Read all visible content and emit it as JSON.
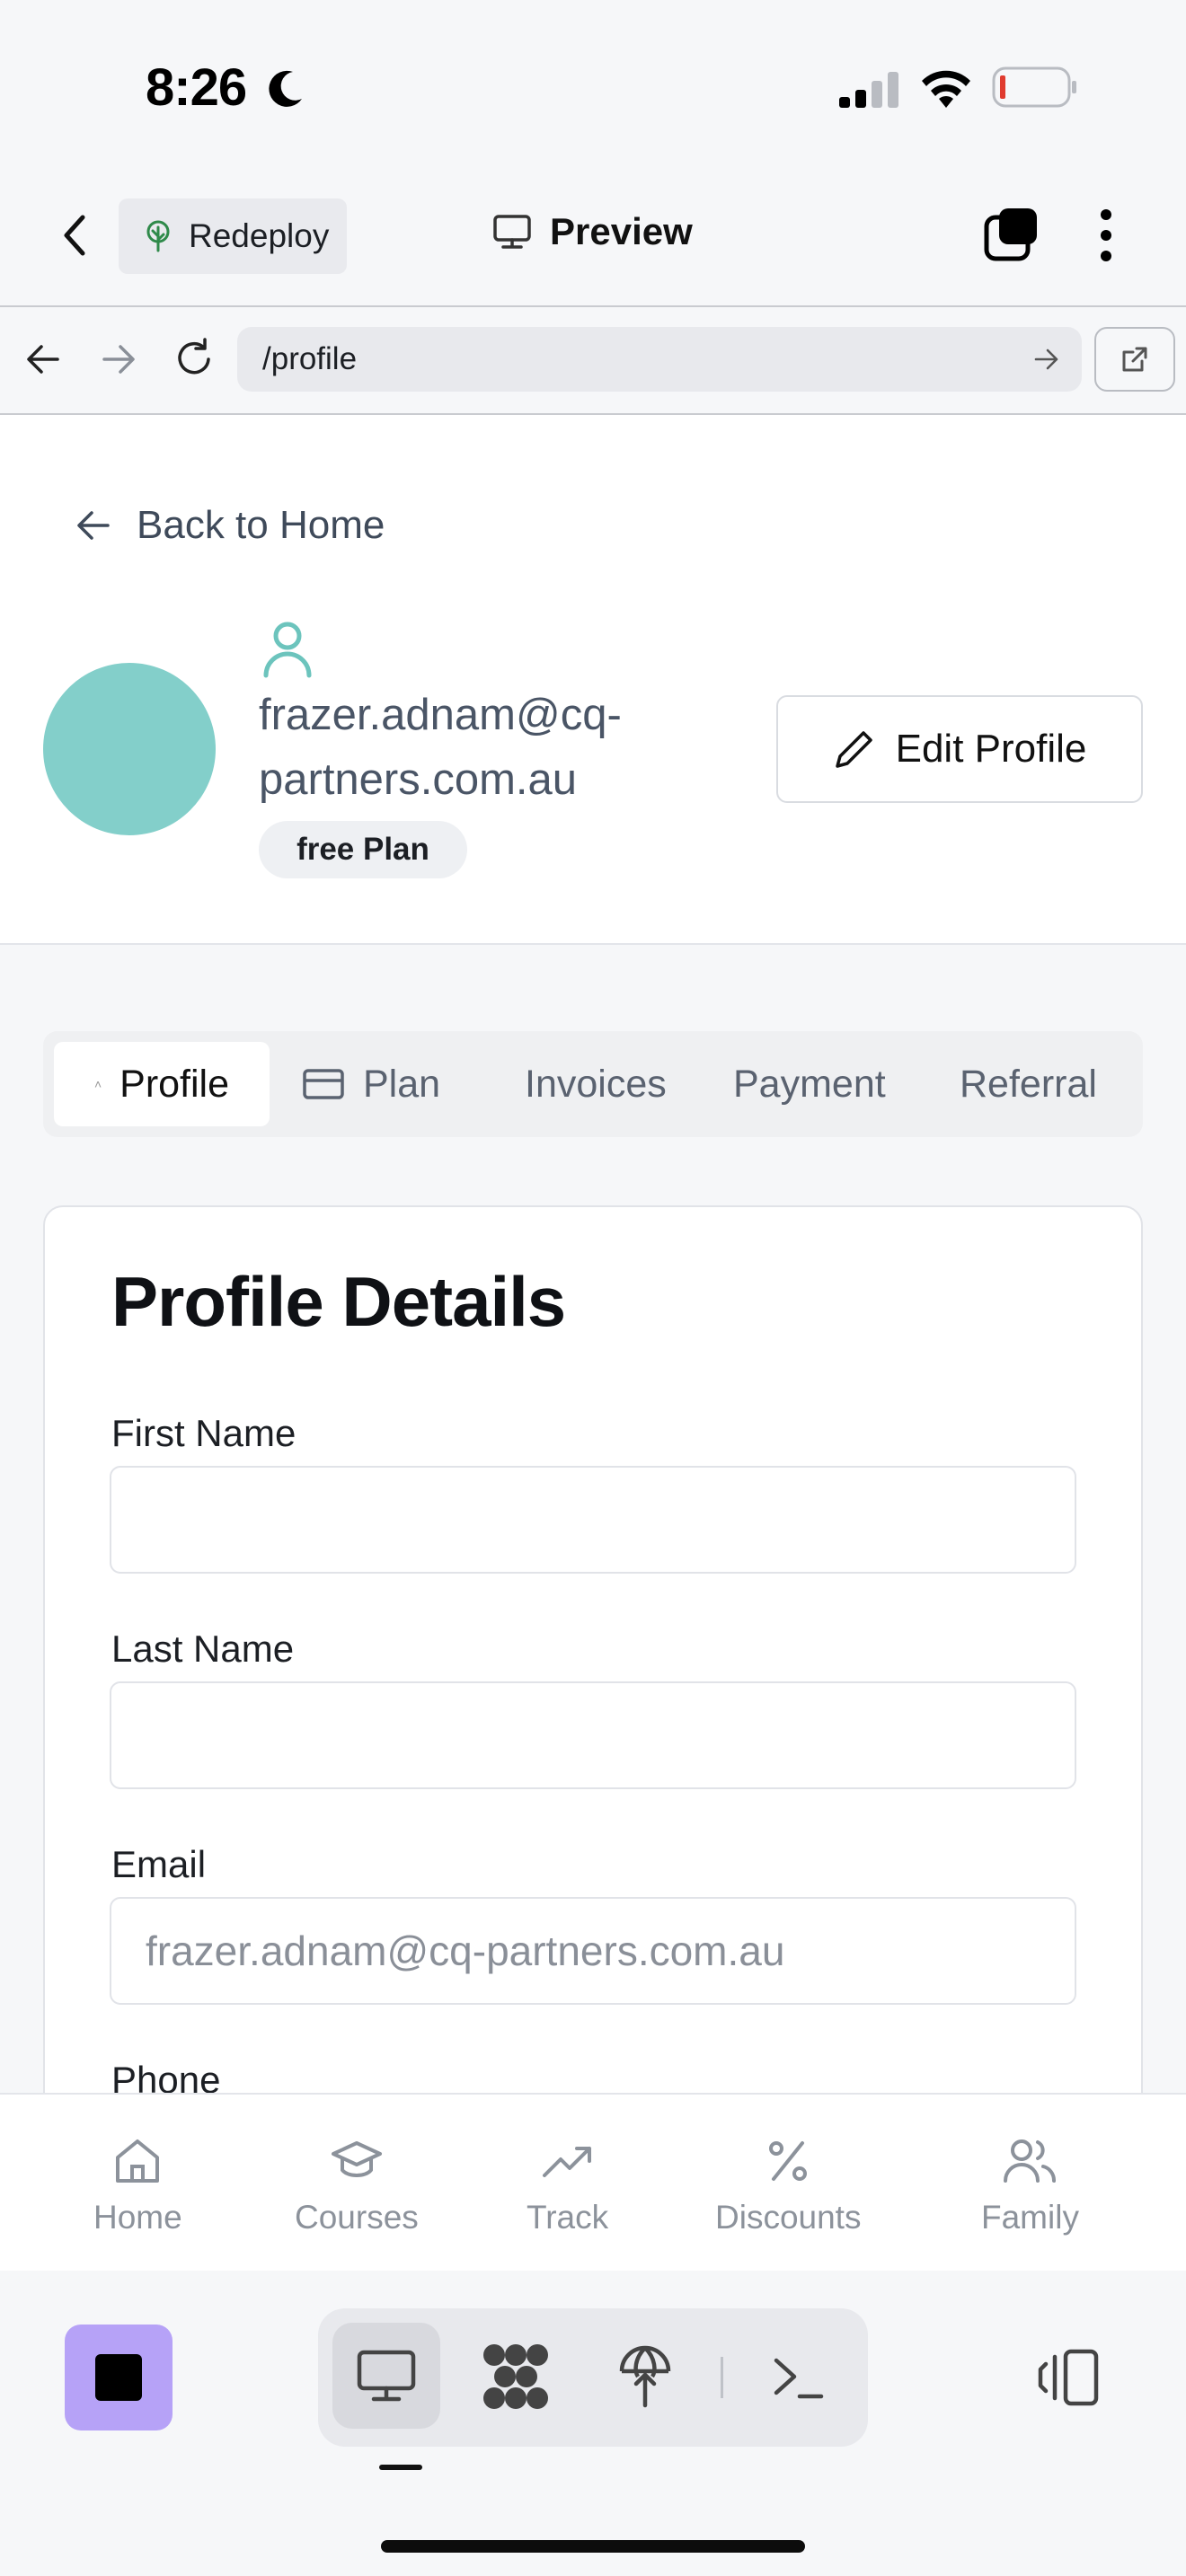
{
  "status_bar": {
    "time": "8:26"
  },
  "app_bar": {
    "chip_label": "Redeploy",
    "title": "Preview"
  },
  "browser": {
    "url": "/profile"
  },
  "page": {
    "back_link": "Back to Home",
    "user": {
      "email_line1": "frazer.adnam@cq-",
      "email_line2": "partners.com.au",
      "plan": "free Plan"
    },
    "edit_profile": "Edit Profile",
    "tabs": [
      "Profile",
      "Plan",
      "Invoices",
      "Payment",
      "Referral"
    ],
    "card": {
      "title": "Profile Details",
      "fields": [
        {
          "label": "First Name",
          "value": ""
        },
        {
          "label": "Last Name",
          "value": ""
        },
        {
          "label": "Email",
          "value": "frazer.adnam@cq-partners.com.au"
        },
        {
          "label": "Phone",
          "value": ""
        }
      ]
    }
  },
  "bottom_nav": [
    "Home",
    "Courses",
    "Track",
    "Discounts",
    "Family"
  ],
  "colors": {
    "avatar": "#83cfca",
    "accent_teal": "#6cc4bd",
    "stop_button": "#b6a2f7"
  },
  "icons": [
    "moon-icon",
    "signal-icon",
    "wifi-icon",
    "battery-icon",
    "chevron-left-icon",
    "tree-icon",
    "monitor-icon",
    "layers-icon",
    "more-vertical-icon",
    "arrow-left-icon",
    "arrow-right-icon",
    "refresh-icon",
    "external-link-icon",
    "user-icon",
    "pencil-icon",
    "credit-card-icon",
    "home-icon",
    "graduation-cap-icon",
    "trending-up-icon",
    "percent-icon",
    "users-icon",
    "stop-icon",
    "desktop-icon",
    "grid-icon",
    "deploy-icon",
    "terminal-icon",
    "split-view-icon"
  ]
}
